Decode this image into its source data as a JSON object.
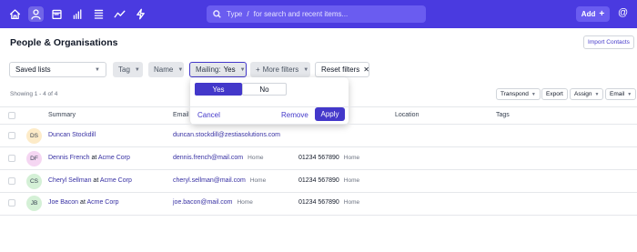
{
  "topbar": {
    "color": "#4a3ae0",
    "nav_icons": [
      "home-icon",
      "person-icon",
      "calendar-icon",
      "bar-chart-icon",
      "list-icon",
      "trend-icon",
      "lightning-icon"
    ],
    "search_prefix": "Type",
    "search_slash": "/",
    "search_suffix": "for search and recent items...",
    "add_label": "Add",
    "add_icon": "plus-icon",
    "at_icon": "@"
  },
  "header": {
    "title": "People & Organisations",
    "import_label": "Import Contacts"
  },
  "filters": {
    "saved_lists": "Saved lists",
    "tag": "Tag",
    "name": "Name",
    "mailing_label": "Mailing:",
    "mailing_value": "Yes",
    "more_filters": "More filters",
    "reset": "Reset filters"
  },
  "popover": {
    "yes": "Yes",
    "no": "No",
    "selected": "Yes",
    "cancel": "Cancel",
    "remove": "Remove",
    "apply": "Apply"
  },
  "table_controls": {
    "showing": "Showing 1 - 4 of 4",
    "transpond": "Transpond",
    "export": "Export",
    "assign": "Assign",
    "email": "Email"
  },
  "columns": {
    "summary": "Summary",
    "email": "Email",
    "location": "Location",
    "tags": "Tags"
  },
  "rows": [
    {
      "initials": "DS",
      "avatar_color": "#fdebc8",
      "name": "Duncan Stockdill",
      "at": "",
      "org": "",
      "email": "duncan.stockdill@zestiasolutions.com",
      "email_type": "",
      "phone": "",
      "phone_type": ""
    },
    {
      "initials": "DF",
      "avatar_color": "#f5d6f2",
      "name": "Dennis French",
      "at": "at",
      "org": "Acme Corp",
      "email": "dennis.french@mail.com",
      "email_type": "Home",
      "phone": "01234 567890",
      "phone_type": "Home"
    },
    {
      "initials": "CS",
      "avatar_color": "#d4f0d6",
      "name": "Cheryl Sellman",
      "at": "at",
      "org": "Acme Corp",
      "email": "cheryl.sellman@mail.com",
      "email_type": "Home",
      "phone": "01234 567890",
      "phone_type": "Home"
    },
    {
      "initials": "JB",
      "avatar_color": "#d4f0d6",
      "name": "Joe Bacon",
      "at": "at",
      "org": "Acme Corp",
      "email": "joe.bacon@mail.com",
      "email_type": "Home",
      "phone": "01234 567890",
      "phone_type": "Home"
    }
  ]
}
